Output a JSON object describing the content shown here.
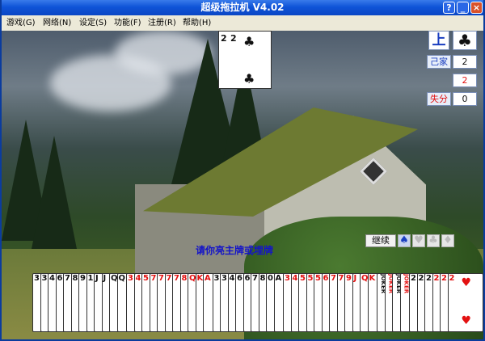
{
  "window": {
    "title": "超级拖拉机 V4.02",
    "help_btn": "?",
    "min_btn": "_",
    "max_btn": "□",
    "close_btn": "×"
  },
  "menu": [
    "游戏(G)",
    "网络(N)",
    "设定(S)",
    "功能(F)",
    "注册(R)",
    "帮助(H)"
  ],
  "played_card": {
    "rank_top": "2",
    "rank_second": "2",
    "suit": "♣"
  },
  "side_panel": {
    "up_label": "上",
    "trump_suit": "♣",
    "self_label": "己家",
    "self_value": "2",
    "other_value": "2",
    "lost_label": "失分",
    "lost_value": "0"
  },
  "continue_label": "继续",
  "suit_buttons": [
    "♠",
    "♥",
    "♣",
    "♦"
  ],
  "message": "请你亮主牌或埋牌",
  "hand": {
    "group1": [
      "3",
      "3",
      "4",
      "6",
      "7",
      "8",
      "9",
      "10",
      "J",
      "J",
      "Q",
      "Q"
    ],
    "group2": [
      "3",
      "4",
      "5",
      "7",
      "7",
      "7",
      "7",
      "8",
      "Q",
      "K",
      "A"
    ],
    "group3": [
      "3",
      "3",
      "4",
      "6",
      "6",
      "7",
      "8",
      "0",
      "A"
    ],
    "group4": [
      "3",
      "4",
      "5",
      "5",
      "5",
      "6",
      "7",
      "7",
      "9",
      "J",
      "Q",
      "K"
    ],
    "jokers": [
      "JOKER",
      "JOKER",
      "JOKER",
      "JOKER"
    ],
    "twos": [
      "2",
      "2",
      "2",
      "2",
      "2"
    ],
    "last": "2"
  }
}
